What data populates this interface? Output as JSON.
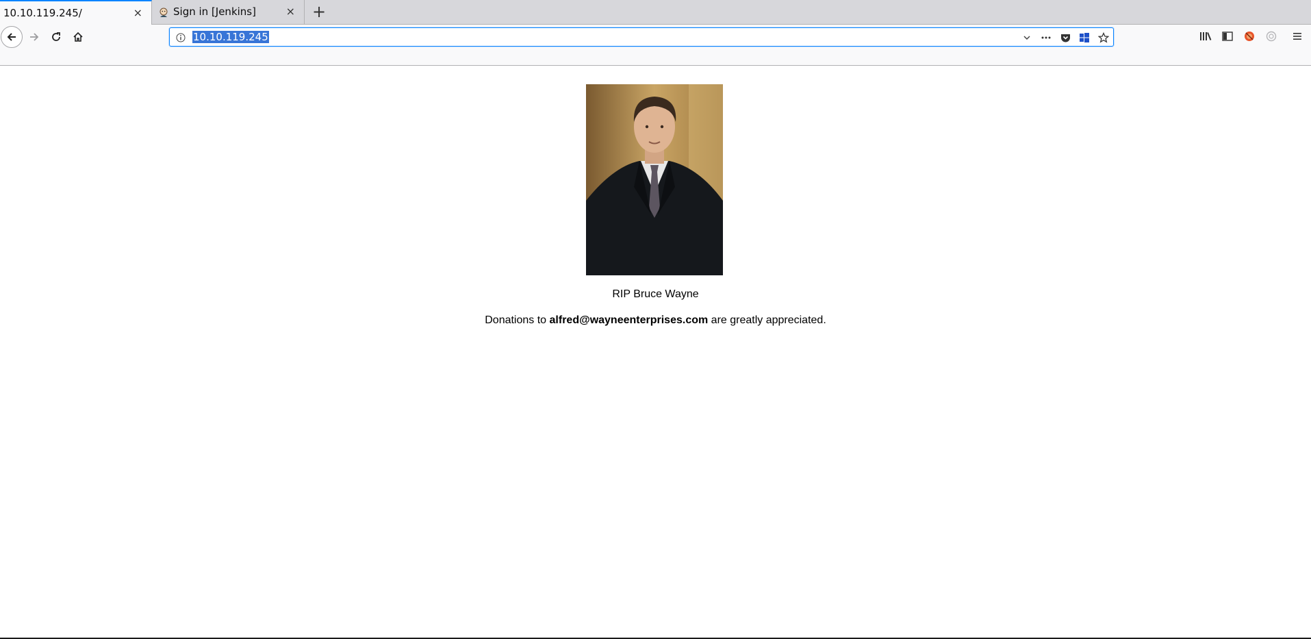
{
  "tabs": [
    {
      "title": "10.10.119.245/",
      "active": true
    },
    {
      "title": "Sign in [Jenkins]",
      "active": false,
      "favicon": "jenkins-icon"
    }
  ],
  "new_tab_label": "+",
  "close_label": "×",
  "toolbar": {
    "url": "10.10.119.245",
    "icons": [
      "back-icon",
      "forward-icon",
      "reload-icon",
      "home-icon",
      "info-icon",
      "dropdown-icon",
      "page-actions-icon",
      "pocket-icon",
      "windows-icon",
      "bookmark-star-icon",
      "library-icon",
      "sidebar-icon",
      "extension-icon",
      "sync-icon",
      "menu-icon"
    ]
  },
  "page": {
    "caption": "RIP Bruce Wayne",
    "donation_prefix": "Donations to ",
    "donation_email": "alfred@wayneenterprises.com",
    "donation_suffix": " are greatly appreciated."
  },
  "colors": {
    "accent": "#0a84ff",
    "selection": "#3875d7",
    "tabstrip": "#d7d7db"
  }
}
